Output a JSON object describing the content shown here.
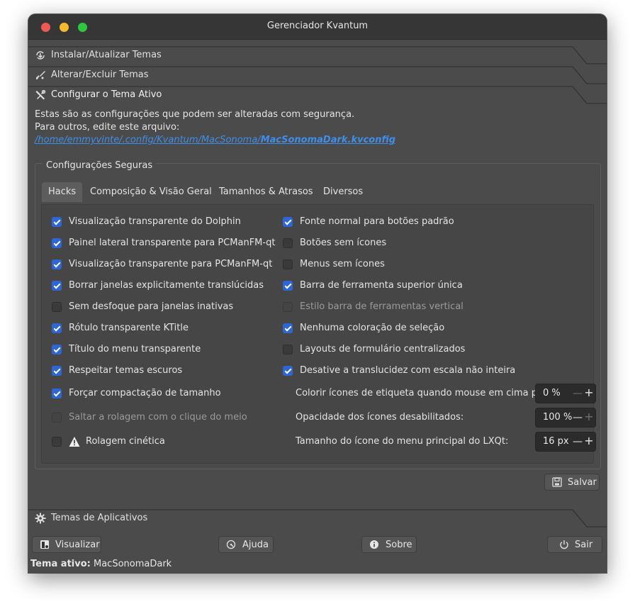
{
  "window": {
    "title": "Gerenciador Kvantum"
  },
  "sections": {
    "install": {
      "label": "Instalar/Atualizar Temas",
      "icon": "install-update-icon"
    },
    "change": {
      "label": "Alterar/Excluir Temas",
      "icon": "brush-icon"
    },
    "configure": {
      "label": "Configurar o Tema Ativo",
      "icon": "tools-icon"
    },
    "app_themes": {
      "label": "Temas de Aplicativos",
      "icon": "gear-icon"
    }
  },
  "info": {
    "line1": "Estas são as configurações que podem ser alteradas com segurança.",
    "line2": "Para outros, edite este arquivo:",
    "path_prefix": "/home/emmyvinte/.config/Kvantum/MacSonoma/",
    "path_file": "MacSonomaDark.kvconfig"
  },
  "group": {
    "title": "Configurações Seguras"
  },
  "tabs": [
    "Hacks",
    "Composição & Visão Geral",
    "Tamanhos & Atrasos",
    "Diversos"
  ],
  "selected_tab": "Hacks",
  "left_checks": [
    {
      "label": "Visualização transparente do Dolphin",
      "checked": true,
      "enabled": true
    },
    {
      "label": "Painel lateral transparente para PCManFM-qt",
      "checked": true,
      "enabled": true
    },
    {
      "label": "Visualização transparente para PCManFM-qt",
      "checked": true,
      "enabled": true
    },
    {
      "label": "Borrar janelas explicitamente translúcidas",
      "checked": true,
      "enabled": true
    },
    {
      "label": "Sem desfoque para janelas inativas",
      "checked": false,
      "enabled": true
    },
    {
      "label": "Rótulo transparente KTitle",
      "checked": true,
      "enabled": true
    },
    {
      "label": "Título do menu transparente",
      "checked": true,
      "enabled": true
    },
    {
      "label": "Respeitar temas escuros",
      "checked": true,
      "enabled": true
    },
    {
      "label": "Forçar compactação de tamanho",
      "checked": true,
      "enabled": true
    },
    {
      "label": "Saltar a rolagem com o clique do meio",
      "checked": false,
      "enabled": false
    },
    {
      "label": "Rolagem cinética",
      "checked": false,
      "enabled": true,
      "icon": "warning-icon"
    }
  ],
  "right_checks": [
    {
      "label": "Fonte normal para botões padrão",
      "checked": true,
      "enabled": true
    },
    {
      "label": "Botões sem ícones",
      "checked": false,
      "enabled": true
    },
    {
      "label": "Menus sem ícones",
      "checked": false,
      "enabled": true
    },
    {
      "label": "Barra de ferramenta superior única",
      "checked": true,
      "enabled": true
    },
    {
      "label": "Estilo barra de ferramentas vertical",
      "checked": false,
      "enabled": false
    },
    {
      "label": "Nenhuma coloração de seleção",
      "checked": true,
      "enabled": true
    },
    {
      "label": "Layouts de formulário centralizados",
      "checked": false,
      "enabled": true
    },
    {
      "label": "Desative a translucidez com escala não inteira",
      "checked": true,
      "enabled": true
    }
  ],
  "spins": [
    {
      "label": "Colorir ícones de etiqueta quando mouse em cima por",
      "value": "0 %"
    },
    {
      "label": "Opacidade dos ícones desabilitados:",
      "value": "100 %"
    },
    {
      "label": "Tamanho do ícone do menu principal do LXQt:",
      "value": "16 px"
    }
  ],
  "buttons": {
    "save": "Salvar",
    "preview": "Visualizar",
    "help": "Ajuda",
    "about": "Sobre",
    "quit": "Sair"
  },
  "status": {
    "prefix": "Tema ativo:",
    "theme": "MacSonomaDark"
  },
  "colors": {
    "accent": "#2f66d6",
    "link": "#3e8ee9",
    "window_bg": "#4b4b4b"
  }
}
